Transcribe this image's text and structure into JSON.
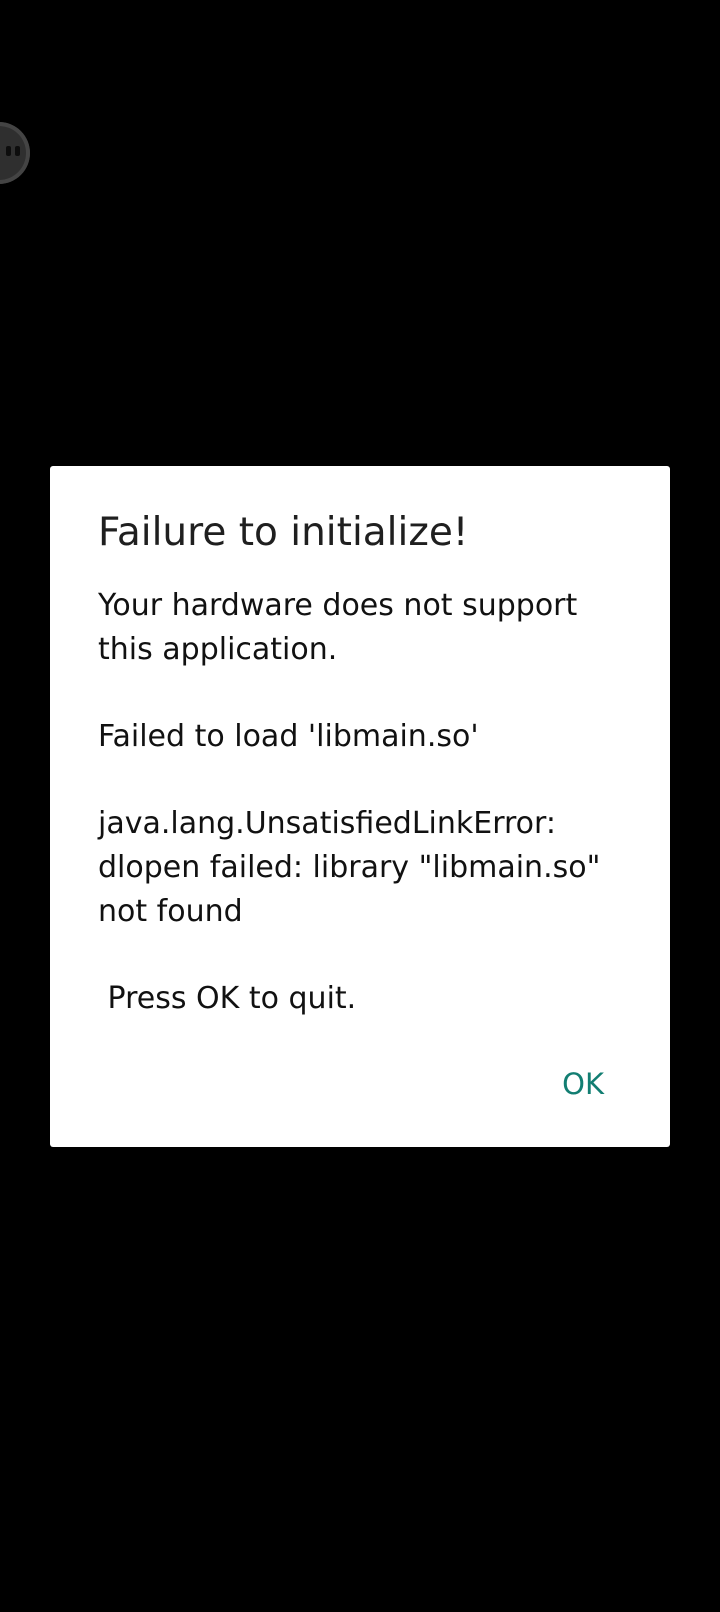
{
  "dialog": {
    "title": "Failure to initialize!",
    "message_hardware": "Your hardware does not support this application.",
    "message_load": "Failed to load 'libmain.so'",
    "message_error": "java.lang.UnsatisfiedLinkError: dlopen failed: library \"libmain.so\" not found",
    "message_quit": " Press OK to quit.",
    "ok_label": "OK"
  },
  "colors": {
    "background": "#000000",
    "dialog_background": "#ffffff",
    "accent": "#127e72"
  },
  "icons": {
    "floating_handle": "floating-assistive-handle-icon"
  }
}
